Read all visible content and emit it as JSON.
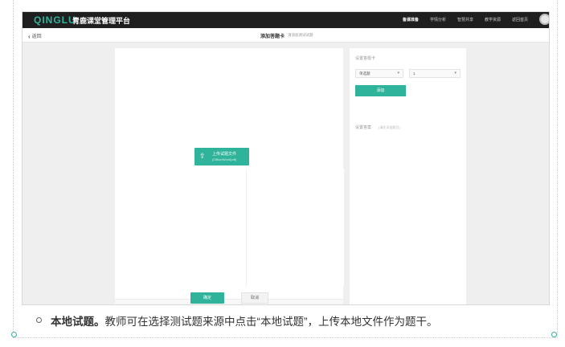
{
  "header": {
    "logo": "QINGLU",
    "platform_name": "青鹿课堂管理平台",
    "nav": [
      "备课准备",
      "学情分析",
      "智慧共享",
      "教学资源",
      "返回首页"
    ]
  },
  "subheader": {
    "back_label": "返回",
    "title": "添加答题卡",
    "hint": "请添加测试试题"
  },
  "left_panel": {
    "upload_title": "上传试题文件",
    "upload_subtitle": "(Office/Word/pdf)"
  },
  "footer": {
    "confirm_label": "确定",
    "cancel_label": "取消"
  },
  "right_panel": {
    "section_label": "设置答题卡",
    "question_type": "单选题",
    "question_count": "1",
    "add_label": "添加",
    "answer_label": "设置答案",
    "answer_hint": "(请先添加题目)"
  },
  "caption": {
    "title": "本地试题。",
    "body": "教师可在选择测试题来源中点击“本地试题”，上传本地文件作为题干。"
  },
  "colors": {
    "accent": "#2fb39a",
    "topbar": "#1f1f1f"
  }
}
